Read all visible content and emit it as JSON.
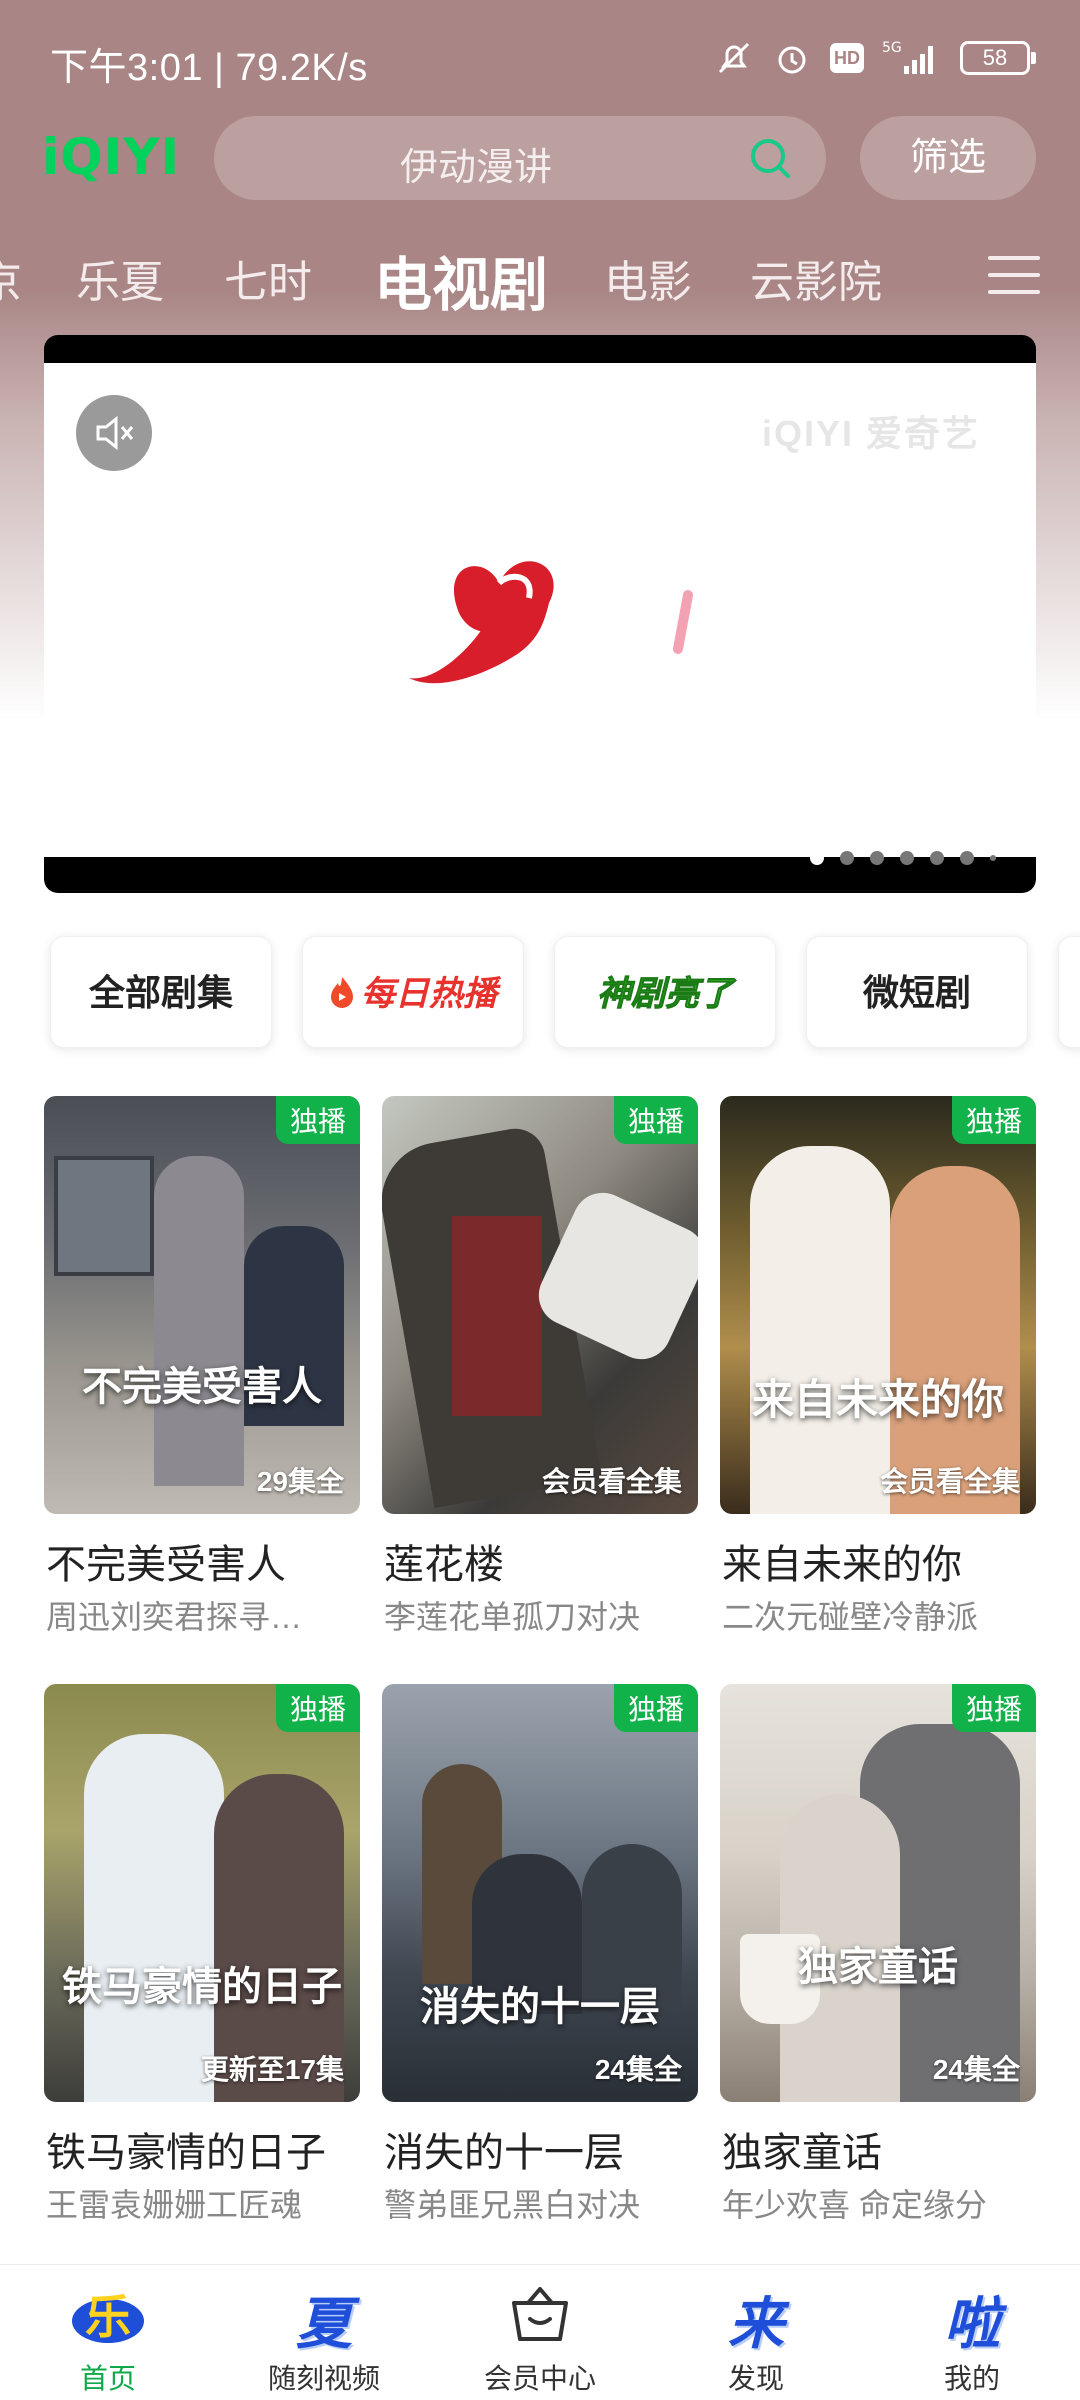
{
  "status_bar": {
    "time_speed": "下午3:01 | 79.2K/s",
    "battery": "58",
    "network": "5G",
    "hd": "HD"
  },
  "header": {
    "logo": "iQIYI",
    "search_placeholder": "伊动漫讲",
    "filter_label": "筛选",
    "tabs": [
      "京",
      "乐夏",
      "七时",
      "电视剧",
      "电影",
      "云影院"
    ],
    "active_tab": "电视剧"
  },
  "banner": {
    "watermark": "iQIYI 爱奇艺",
    "slide_count": 7,
    "active_slide": 1
  },
  "chips": [
    {
      "label": "全部剧集"
    },
    {
      "label": "每日热播"
    },
    {
      "label": "神剧亮了"
    },
    {
      "label": "微短剧"
    }
  ],
  "cards": [
    {
      "title": "不完美受害人",
      "subtitle": "周迅刘奕君探寻…",
      "badge": "独播",
      "episodes": "29集全",
      "poster_text": "不完美受害人"
    },
    {
      "title": "莲花楼",
      "subtitle": "李莲花单孤刀对决",
      "badge": "独播",
      "episodes": "会员看全集",
      "poster_text": ""
    },
    {
      "title": "来自未来的你",
      "subtitle": "二次元碰壁冷静派",
      "badge": "独播",
      "episodes": "会员看全集",
      "poster_text": "来自未来的你"
    },
    {
      "title": "铁马豪情的日子",
      "subtitle": "王雷袁姗姗工匠魂",
      "badge": "独播",
      "episodes": "更新至17集",
      "poster_text": "铁马豪情的日子"
    },
    {
      "title": "消失的十一层",
      "subtitle": "警弟匪兄黑白对决",
      "badge": "独播",
      "episodes": "24集全",
      "poster_text": "消失的十一层"
    },
    {
      "title": "独家童话",
      "subtitle": "年少欢喜 命定缘分",
      "badge": "独播",
      "episodes": "24集全",
      "poster_text": "独家童话"
    }
  ],
  "bottom_nav": [
    {
      "label": "首页",
      "icon_char": "乐",
      "active": true
    },
    {
      "label": "随刻视频",
      "icon_char": "夏"
    },
    {
      "label": "会员中心",
      "icon_char": ""
    },
    {
      "label": "发现",
      "icon_char": "来"
    },
    {
      "label": "我的",
      "icon_char": "啦"
    }
  ],
  "colors": {
    "header_bg": "#a98585",
    "brand_green": "#00d25b",
    "badge_green": "#12b24a",
    "nav_active": "#0fa84a",
    "nav_char_blue": "#1f4fd8"
  }
}
